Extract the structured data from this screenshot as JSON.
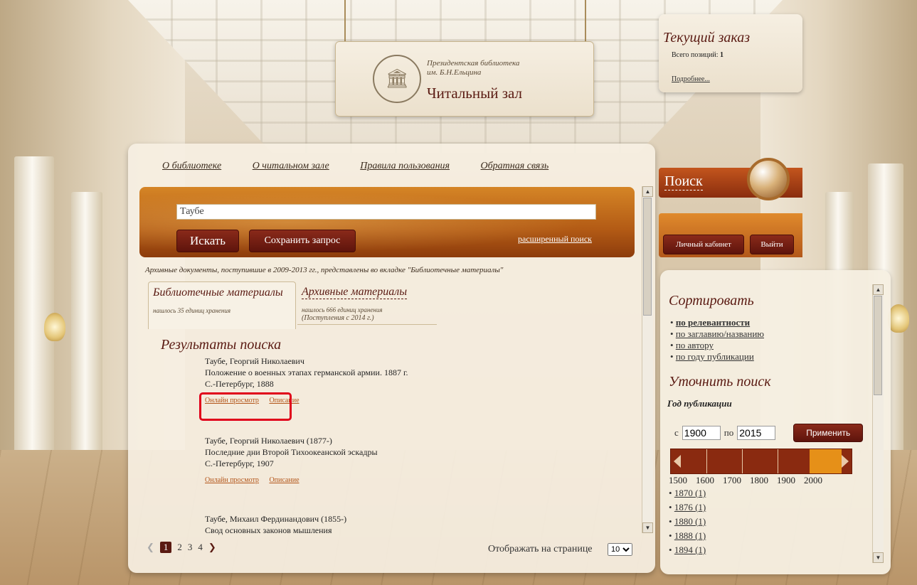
{
  "header": {
    "library_line1": "Президентская библиотека",
    "library_line2": "им. Б.Н.Ельцина",
    "title": "Читальный зал"
  },
  "order": {
    "title": "Текущий заказ",
    "total_label": "Всего позиций:",
    "total_value": "1",
    "more": "Подробнее..."
  },
  "nav": [
    "О библиотеке",
    "О читальном зале",
    "Правила пользования",
    "Обратная связь"
  ],
  "search": {
    "query": "Таубе",
    "search_button": "Искать",
    "save_button": "Сохранить запрос",
    "advanced": "расширенный поиск"
  },
  "notice": "Архивные документы, поступившие в 2009-2013 гг., представлены во вкладке \"Библиотечные материалы\"",
  "tabs": [
    {
      "title": "Библиотечные материалы",
      "sub": "нашлось 35 единиц хранения",
      "sub2": ""
    },
    {
      "title": "Архивные материалы",
      "sub": "нашлось 666 единиц хранения",
      "sub2": "(Поступления с 2014 г.)"
    }
  ],
  "results_title": "Результаты поиска",
  "results": [
    {
      "author": "Таубе, Георгий Николаевич",
      "title": "Положение о военных этапах германской армии. 1887 г.",
      "place": "С.-Петербург, 1888",
      "link_view": "Онлайн просмотр",
      "link_desc": "Описание"
    },
    {
      "author": "Таубе, Георгий Николаевич (1877-)",
      "title": "Последние дни Второй Тихоокеанской эскадры",
      "place": "С.-Петербург, 1907",
      "link_view": "Онлайн просмотр",
      "link_desc": "Описание"
    },
    {
      "author": "Таубе, Михаил Фердинандович (1855-)",
      "title": "Свод основных законов мышления",
      "place": "",
      "link_view": "",
      "link_desc": ""
    }
  ],
  "pagination": {
    "pages": [
      "1",
      "2",
      "3",
      "4"
    ],
    "current": "1"
  },
  "per_page": {
    "label": "Отображать на странице",
    "value": "10"
  },
  "right": {
    "search_tab": "Поиск",
    "cabinet": "Личный кабинет",
    "logout": "Выйти",
    "sort_title": "Сортировать",
    "sort_options": [
      "по релевантности",
      "по заглавию/названию",
      "по автору",
      "по году публикации"
    ],
    "refine_title": "Уточнить поиск",
    "year_label": "Год публикации",
    "from_label": "с",
    "from_value": "1900",
    "to_label": "по",
    "to_value": "2015",
    "apply": "Применить",
    "axis": [
      "1500",
      "1600",
      "1700",
      "1800",
      "1900",
      "2000"
    ],
    "slider": {
      "min": 1500,
      "max": 2000,
      "from": 1900,
      "to": 2015
    },
    "years": [
      "1870 (1)",
      "1876 (1)",
      "1880 (1)",
      "1888 (1)",
      "1894 (1)"
    ]
  },
  "colors": {
    "accent": "#5a1a12",
    "orange": "#e69018",
    "highlight": "#e0001a"
  }
}
